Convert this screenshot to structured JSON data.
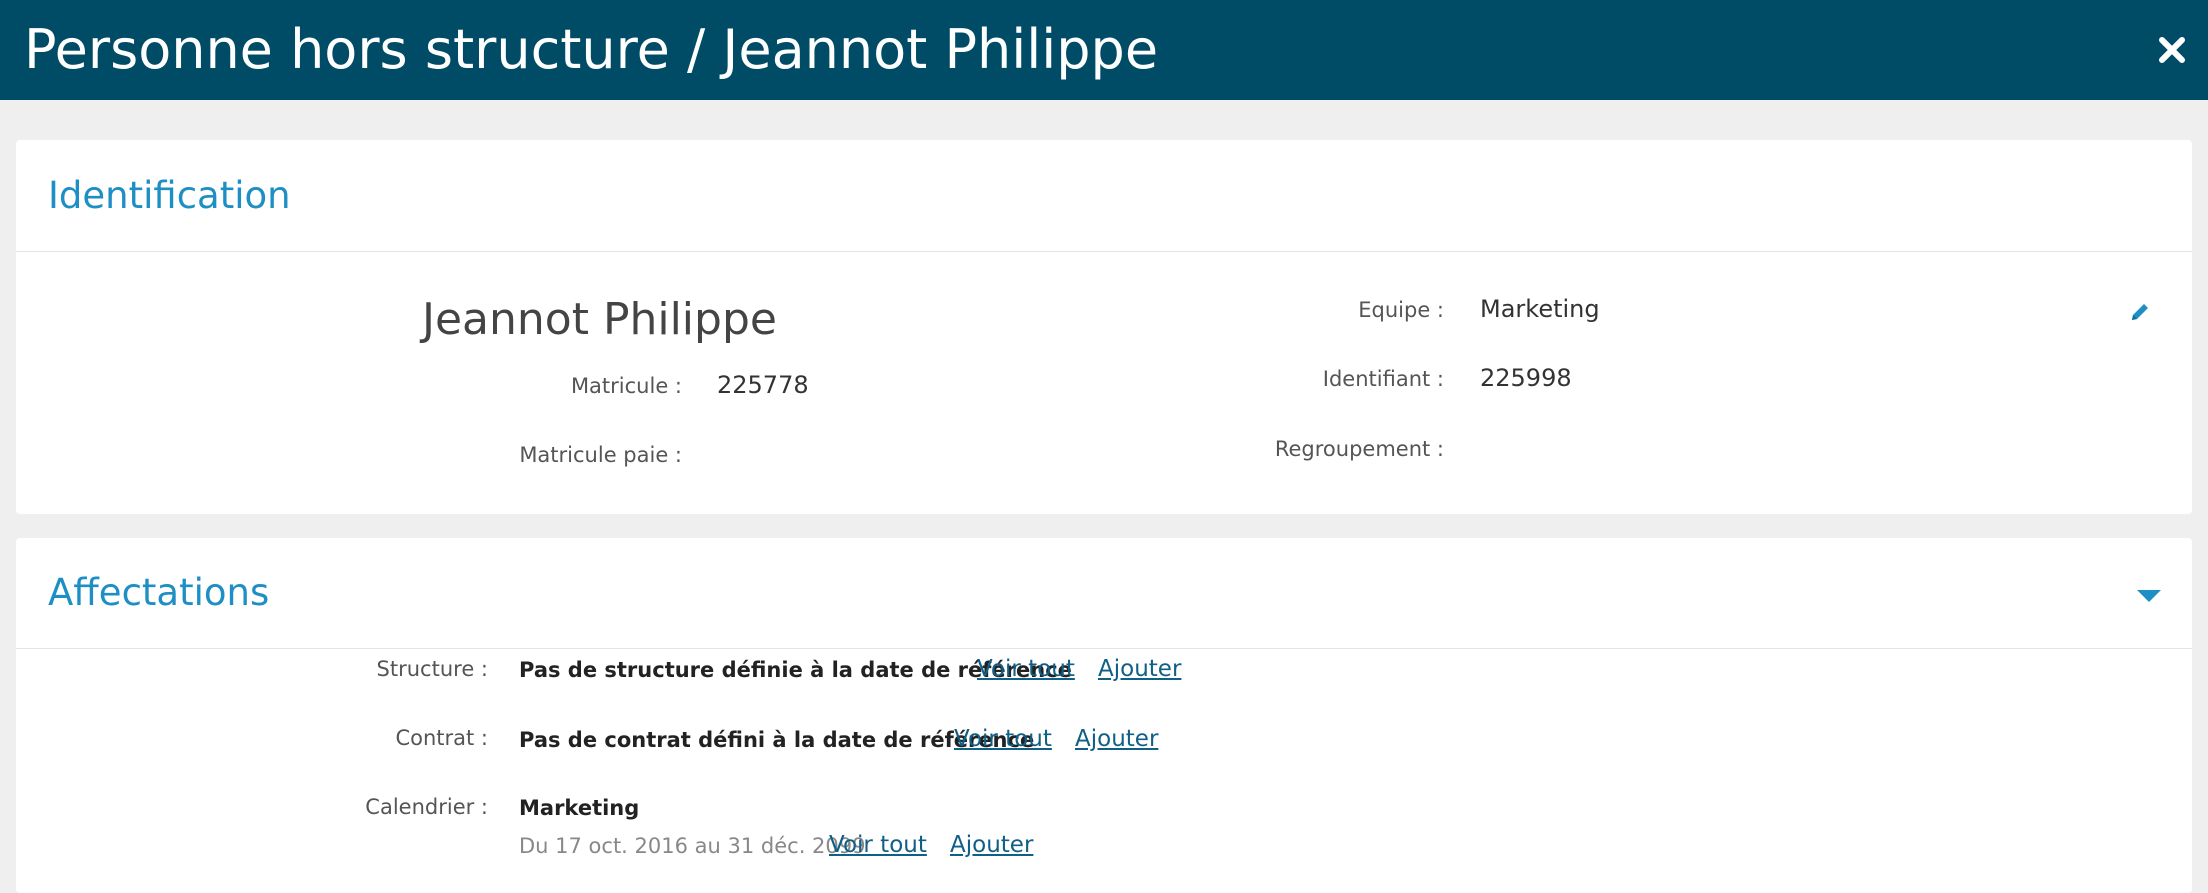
{
  "header": {
    "title": "Personne hors structure / Jeannot Philippe",
    "close_icon": "close-icon",
    "background": "#004c66"
  },
  "identification": {
    "title": "Identification",
    "name": "Jeannot Philippe",
    "matricule_label": "Matricule :",
    "matricule_value": "225778",
    "matricule_paie_label": "Matricule paie :",
    "matricule_paie_value": "",
    "equipe_label": "Equipe :",
    "equipe_value": "Marketing",
    "identifiant_label": "Identifiant :",
    "identifiant_value": "225998",
    "regroupement_label": "Regroupement :",
    "regroupement_value": "",
    "edit_icon": "pencil-icon"
  },
  "affectations": {
    "title": "Affectations",
    "toggle_icon": "chevron-down-icon",
    "structure": {
      "label": "Structure :",
      "value": "Pas de structure définie à la date de référence",
      "voir_tout": "Voir tout",
      "ajouter": "Ajouter"
    },
    "contrat": {
      "label": "Contrat :",
      "value": "Pas de contrat défini à la date de référence",
      "voir_tout": "Voir tout",
      "ajouter": "Ajouter"
    },
    "calendrier": {
      "label": "Calendrier :",
      "value": "Marketing",
      "period": "Du 17 oct. 2016 au 31 déc. 2099",
      "voir_tout": "Voir tout",
      "ajouter": "Ajouter"
    }
  },
  "colors": {
    "accent": "#1e8fc4",
    "link": "#0f5f86",
    "page_bg": "#efefef"
  }
}
